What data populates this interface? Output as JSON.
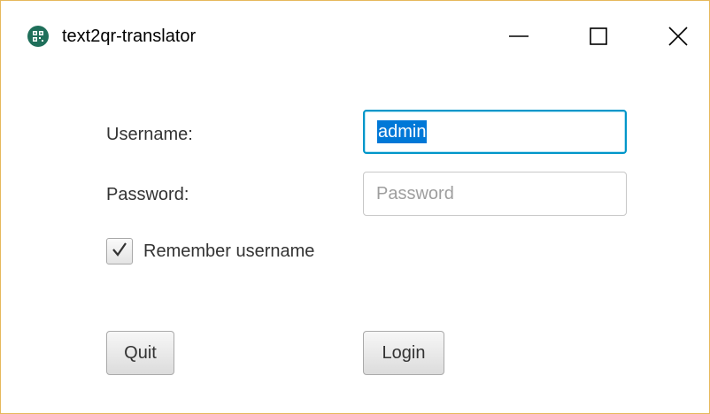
{
  "window": {
    "title": "text2qr-translator",
    "icon": "qr-code-icon",
    "border_color": "#e6b85c",
    "controls": [
      "minimize-icon",
      "maximize-icon",
      "close-icon"
    ]
  },
  "form": {
    "username_label": "Username:",
    "username_value": "admin",
    "password_label": "Password:",
    "password_placeholder": "Password",
    "remember_label": "Remember username",
    "remember_checked": true,
    "focus_color": "#0096c9",
    "selection_color": "#0078d7"
  },
  "buttons": {
    "quit_label": "Quit",
    "login_label": "Login"
  }
}
